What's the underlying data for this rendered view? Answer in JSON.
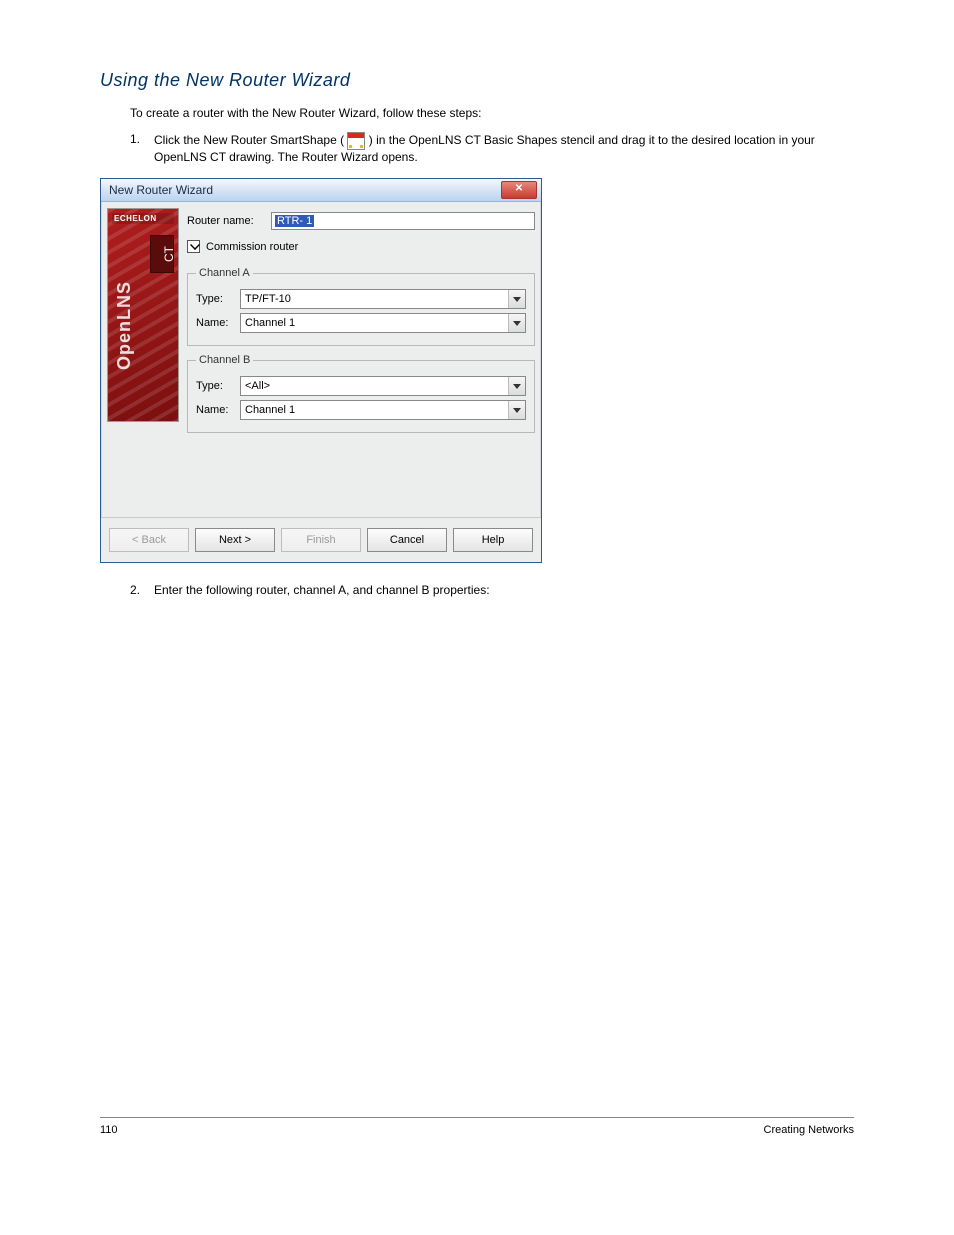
{
  "page": {
    "heading": "Using the New Router Wizard",
    "intro": "To create a router with the New Router Wizard, follow these steps:",
    "step1_num": "1.",
    "step1_before": "Click the New Router SmartShape (",
    "step1_after": ") in the OpenLNS CT Basic Shapes stencil and drag it to the desired location in your OpenLNS CT drawing. The Router Wizard opens.",
    "step2_num": "2.",
    "step2": "Enter the following router, channel A, and channel B properties:"
  },
  "dialog": {
    "title": "New Router Wizard",
    "close": "✕",
    "sidebar_brand": "ECHELON",
    "sidebar_ct": "CT",
    "sidebar_product": "OpenLNS",
    "router_name_label": "Router name:",
    "router_name_value": "RTR- 1",
    "commission_label": "Commission router",
    "channelA": {
      "legend": "Channel A",
      "type_label": "Type:",
      "type_value": "TP/FT-10",
      "name_label": "Name:",
      "name_value": "Channel 1"
    },
    "channelB": {
      "legend": "Channel B",
      "type_label": "Type:",
      "type_value": "<All>",
      "name_label": "Name:",
      "name_value": "Channel 1"
    },
    "buttons": {
      "back": "< Back",
      "next": "Next >",
      "finish": "Finish",
      "cancel": "Cancel",
      "help": "Help"
    }
  },
  "footer": {
    "left": "110",
    "right": "Creating Networks"
  }
}
